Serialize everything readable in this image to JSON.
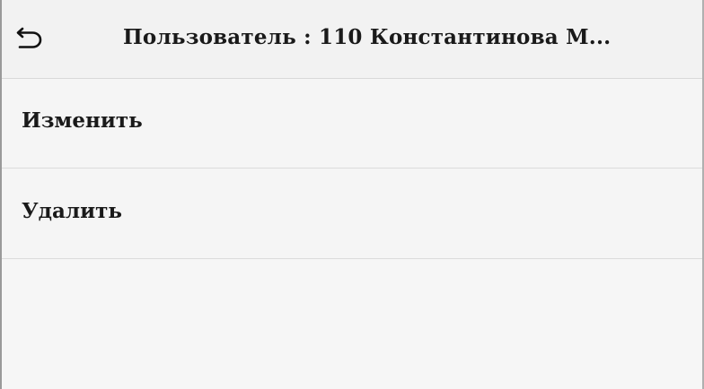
{
  "header": {
    "back_icon": "undo-arrow-icon",
    "title": "Пользователь : 110 Константинова М..."
  },
  "menu": {
    "items": [
      {
        "label": "Изменить"
      },
      {
        "label": "Удалить"
      }
    ]
  }
}
